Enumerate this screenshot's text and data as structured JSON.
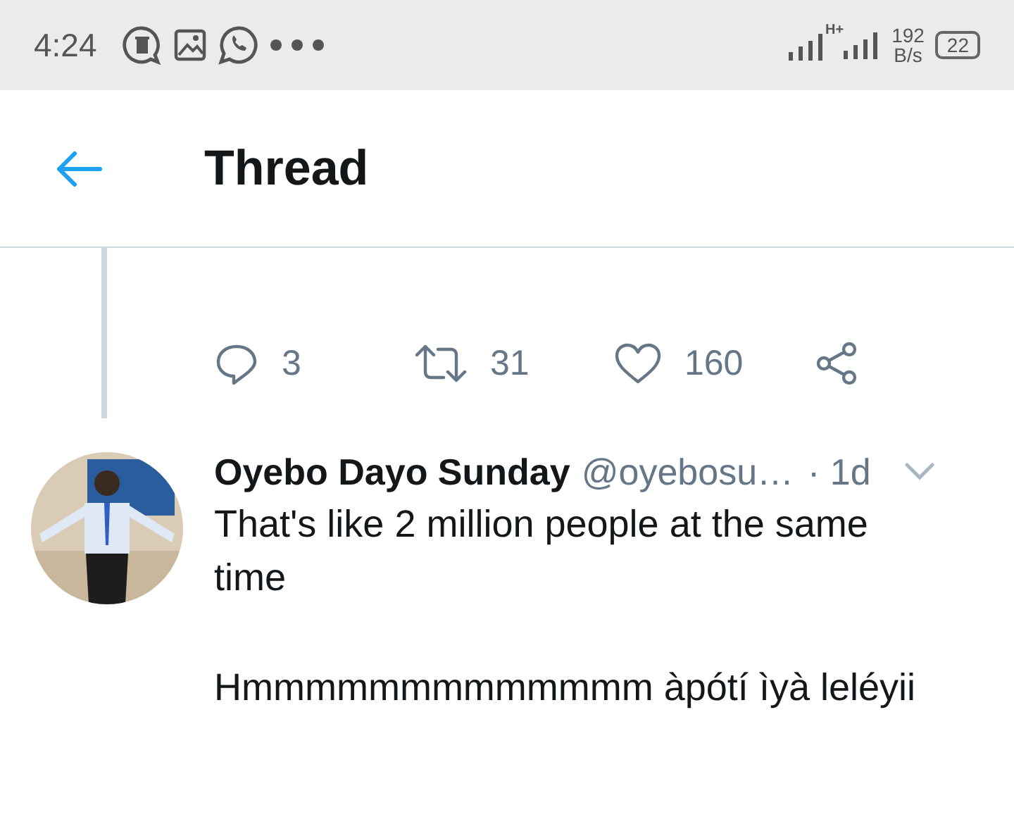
{
  "status_bar": {
    "time": "4:24",
    "network": "H+",
    "speed_value": "192",
    "speed_unit": "B/s",
    "battery": "22"
  },
  "header": {
    "title": "Thread"
  },
  "parent_tweet": {
    "replies": "3",
    "retweets": "31",
    "likes": "160"
  },
  "reply": {
    "name": "Oyebo Dayo Sunday",
    "handle": "@oyebosu…",
    "time": "· 1d",
    "paragraphs": [
      "That's like 2 million people at the same time",
      "Hmmmmmmmmmmmmm àpótí ìyà leléyii"
    ]
  }
}
